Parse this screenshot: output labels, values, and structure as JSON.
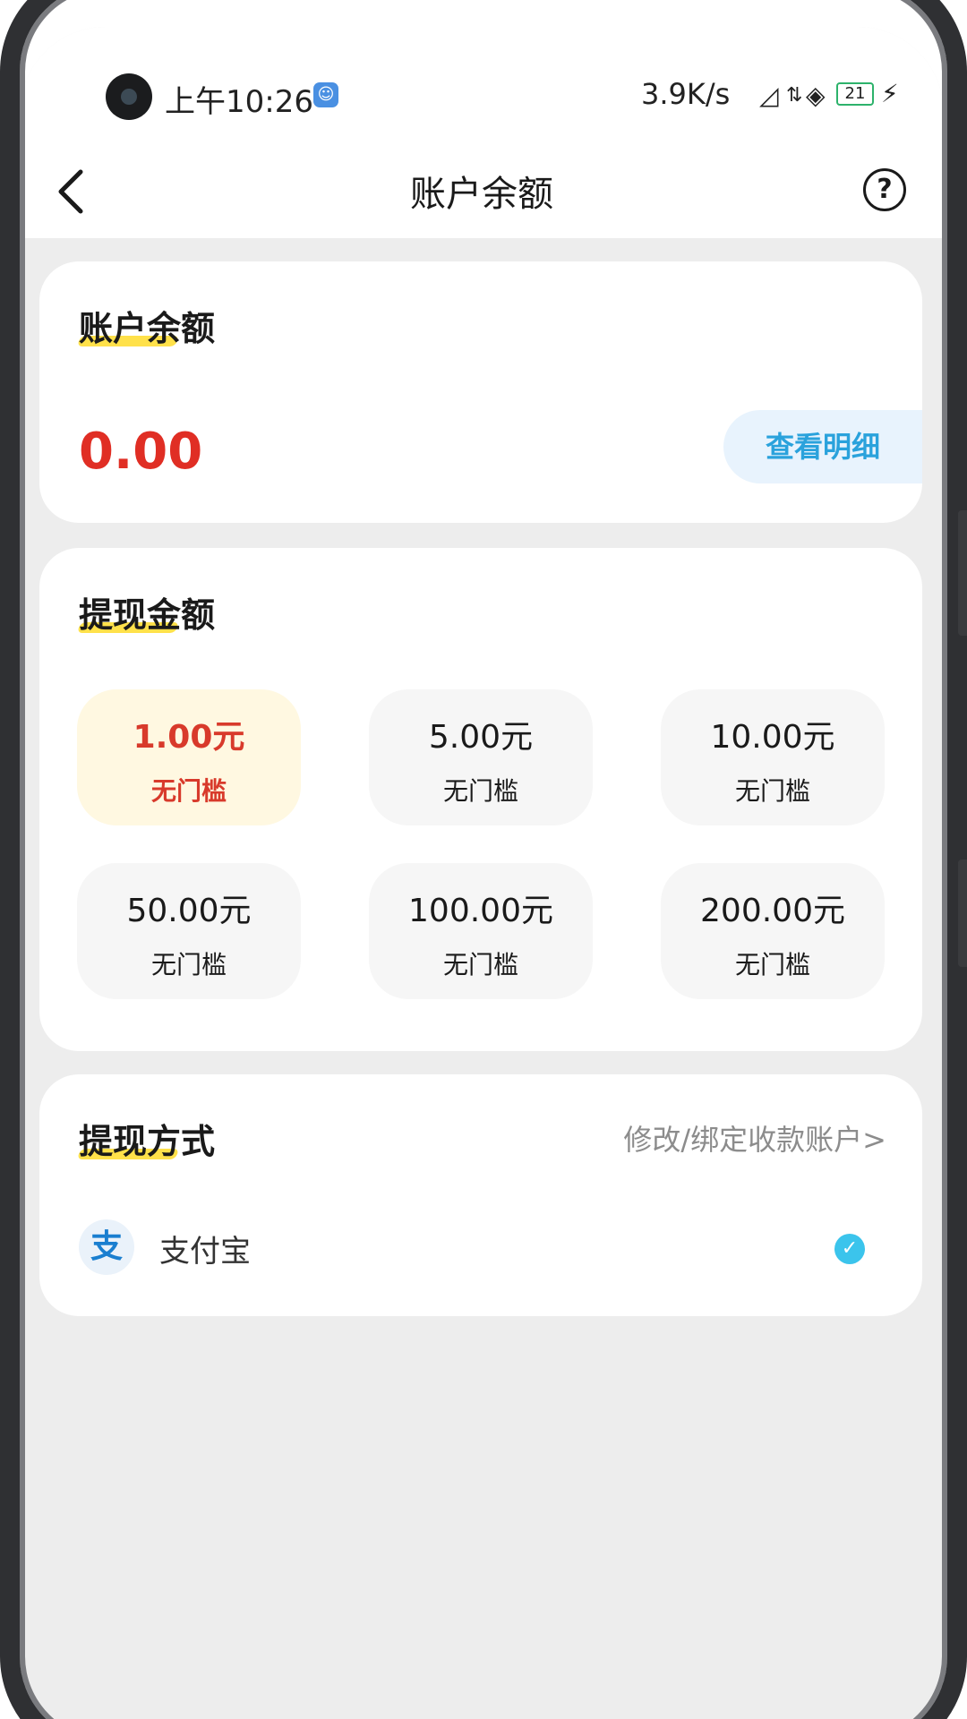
{
  "status_bar": {
    "time": "上午10:26",
    "net_speed": "3.9K/s",
    "battery": "21"
  },
  "nav": {
    "title": "账户余额",
    "help": "?"
  },
  "balance_card": {
    "heading": "账户余额",
    "value": "0.00",
    "detail_button": "查看明细"
  },
  "withdraw_card": {
    "heading": "提现金额",
    "options": [
      {
        "amount": "1.00元",
        "note": "无门槛",
        "selected": true
      },
      {
        "amount": "5.00元",
        "note": "无门槛",
        "selected": false
      },
      {
        "amount": "10.00元",
        "note": "无门槛",
        "selected": false
      },
      {
        "amount": "50.00元",
        "note": "无门槛",
        "selected": false
      },
      {
        "amount": "100.00元",
        "note": "无门槛",
        "selected": false
      },
      {
        "amount": "200.00元",
        "note": "无门槛",
        "selected": false
      }
    ]
  },
  "method_card": {
    "heading": "提现方式",
    "edit_link": "修改/绑定收款账户>",
    "method_label": "支付宝",
    "method_logo": "支"
  },
  "colors": {
    "accent_red": "#e02e24",
    "accent_blue": "#2aa2dc",
    "highlight_yellow": "#ffe14a",
    "check_blue": "#3bc4ec"
  },
  "icons": {
    "back": "chevron-left-icon",
    "help": "question-circle-icon",
    "check": "check-circle-icon",
    "alipay": "alipay-icon"
  }
}
